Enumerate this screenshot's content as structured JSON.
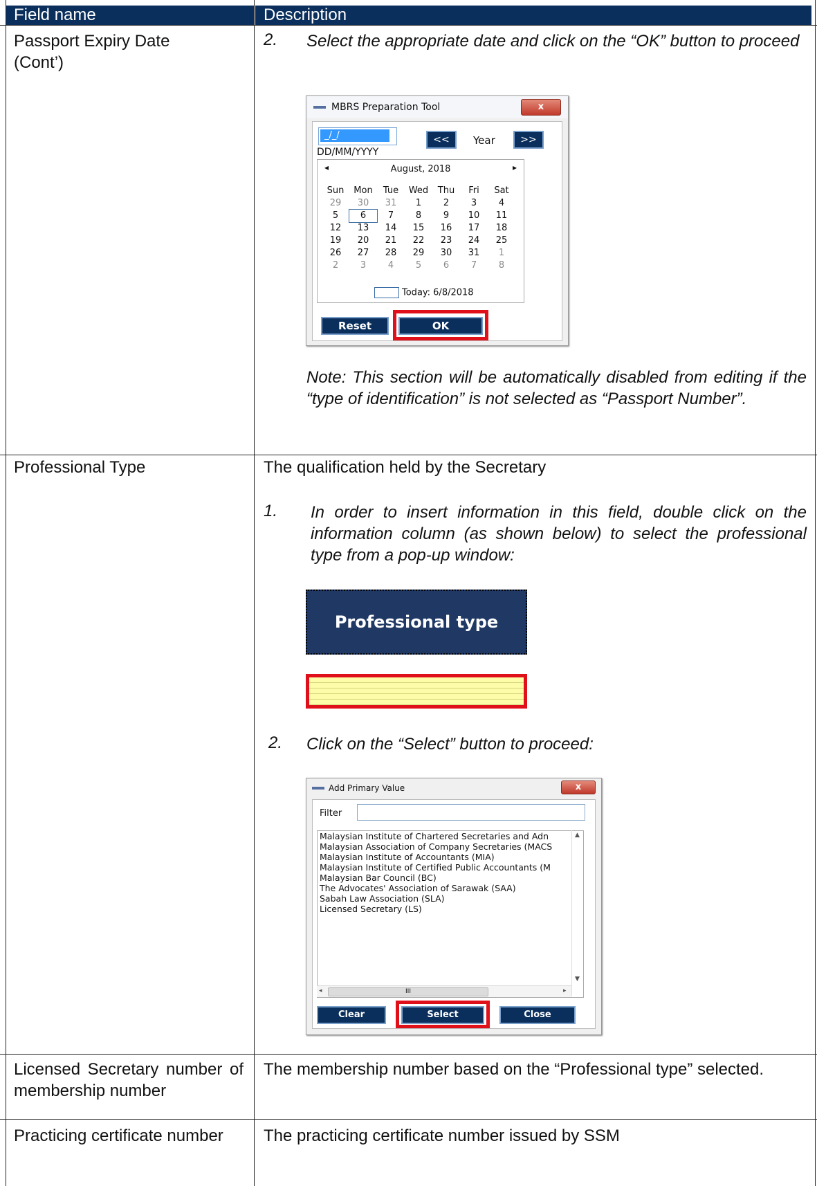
{
  "header": {
    "col1": "Field name",
    "col2": "Description"
  },
  "rows": [
    {
      "field": [
        "Passport Expiry Date",
        "(Cont’)"
      ],
      "step2_num": "2.",
      "step2_text": "Select the appropriate date and click on the “OK” button to proceed",
      "note": "Note: This section will be automatically disabled from editing if the “type of identification” is not selected as “Passport Number”."
    },
    {
      "field": [
        "Professional Type"
      ],
      "intro": "The qualification held by the Secretary",
      "step1_num": "1.",
      "step1_text": "In order to insert information in this field, double click on the information column (as shown below) to select the professional type from a pop-up window:",
      "step2_num": "2.",
      "step2_text": "Click on the “Select” button to proceed:"
    },
    {
      "field": "Licensed Secretary number of membership number",
      "desc": "The membership number based on the “Professional type” selected."
    },
    {
      "field": "Practicing certificate number",
      "desc": "The practicing certificate number issued by SSM"
    }
  ],
  "date_dialog": {
    "title": "MBRS Preparation Tool",
    "close_glyph": "x",
    "date_value": "_/_/",
    "prev_label": "<<",
    "year_label": "Year",
    "next_label": ">>",
    "format_hint": "DD/MM/YYYY",
    "month_label": "August, 2018",
    "prev_arrow": "◂",
    "next_arrow": "▸",
    "weekdays": [
      "Sun",
      "Mon",
      "Tue",
      "Wed",
      "Thu",
      "Fri",
      "Sat"
    ],
    "weeks": [
      [
        "29",
        "30",
        "31",
        "1",
        "2",
        "3",
        "4"
      ],
      [
        "5",
        "6",
        "7",
        "8",
        "9",
        "10",
        "11"
      ],
      [
        "12",
        "13",
        "14",
        "15",
        "16",
        "17",
        "18"
      ],
      [
        "19",
        "20",
        "21",
        "22",
        "23",
        "24",
        "25"
      ],
      [
        "26",
        "27",
        "28",
        "29",
        "30",
        "31",
        "1"
      ],
      [
        "2",
        "3",
        "4",
        "5",
        "6",
        "7",
        "8"
      ]
    ],
    "today_label": "Today: 6/8/2018",
    "reset_label": "Reset",
    "ok_label": "OK"
  },
  "professional_field": {
    "label": "Professional type"
  },
  "value_dialog": {
    "title": "Add Primary Value",
    "close_glyph": "x",
    "filter_label": "Filter",
    "filter_value": "",
    "options": [
      "Malaysian Institute of Chartered Secretaries and Adn",
      "Malaysian Association of Company Secretaries (MACS",
      "Malaysian Institute of Accountants (MIA)",
      "Malaysian Institute of Certified Public Accountants (M",
      "Malaysian Bar Council (BC)",
      "The Advocates' Association of Sarawak (SAA)",
      "Sabah Law Association (SLA)",
      "Licensed Secretary (LS)"
    ],
    "scroll_thumb": "III",
    "clear_label": "Clear",
    "select_label": "Select",
    "close_label": "Close"
  }
}
